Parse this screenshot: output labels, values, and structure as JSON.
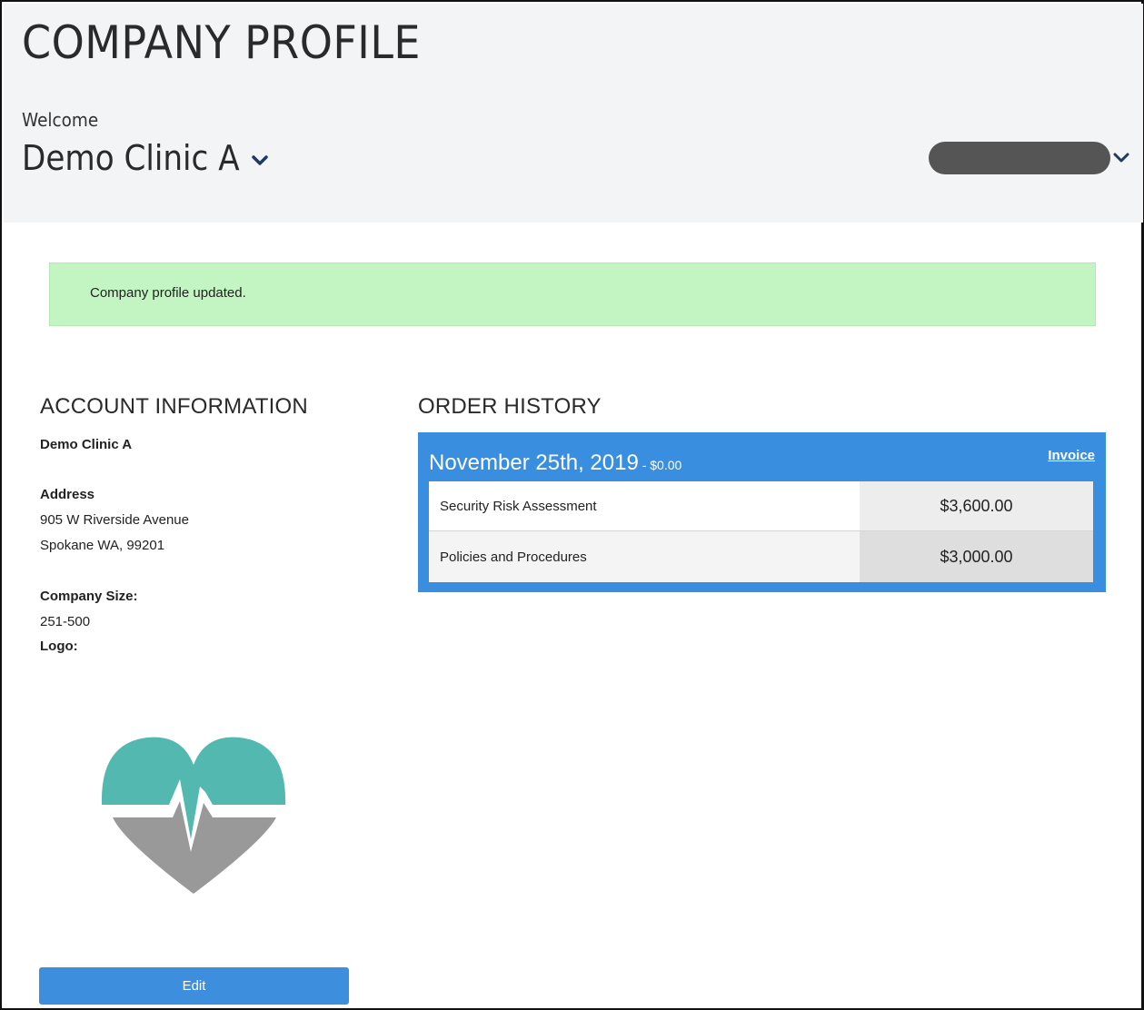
{
  "header": {
    "title": "COMPANY PROFILE",
    "welcome": "Welcome",
    "company_name": "Demo Clinic A"
  },
  "alert": {
    "message": "Company profile updated."
  },
  "account": {
    "heading": "ACCOUNT INFORMATION",
    "name": "Demo Clinic A",
    "address_label": "Address",
    "address_line1": "905 W Riverside Avenue",
    "address_line2": "Spokane WA, 99201",
    "size_label": "Company Size:",
    "size_value": "251-500",
    "logo_label": "Logo:",
    "edit_label": "Edit"
  },
  "orders": {
    "heading": "ORDER HISTORY",
    "date": "November 25th, 2019",
    "separator": " - ",
    "total": "$0.00",
    "invoice_label": "Invoice",
    "items": [
      {
        "name": "Security Risk Assessment",
        "price": "$3,600.00"
      },
      {
        "name": "Policies and Procedures",
        "price": "$3,000.00"
      }
    ]
  },
  "colors": {
    "accent_blue": "#3a8edf",
    "alert_green": "#c2f5c2",
    "logo_teal": "#52b8b0",
    "logo_gray": "#999999"
  }
}
